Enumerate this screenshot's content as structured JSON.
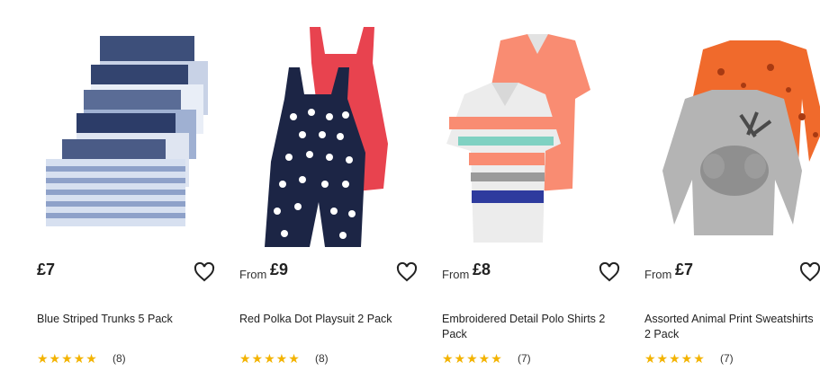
{
  "products": [
    {
      "from_label": "",
      "price": "£7",
      "title": "Blue Striped Trunks 5 Pack",
      "stars": "★★★★★",
      "reviews": "(8)",
      "image_icon": "striped-trunks-image"
    },
    {
      "from_label": "From",
      "price": "£9",
      "title": "Red Polka Dot Playsuit 2 Pack",
      "stars": "★★★★★",
      "reviews": "(8)",
      "image_icon": "polka-dot-playsuit-image"
    },
    {
      "from_label": "From",
      "price": "£8",
      "title": "Embroidered Detail Polo Shirts 2 Pack",
      "stars": "★★★★★",
      "reviews": "(7)",
      "image_icon": "polo-shirts-image"
    },
    {
      "from_label": "From",
      "price": "£7",
      "title": "Assorted Animal Print Sweatshirts 2 Pack",
      "stars": "★★★★★",
      "reviews": "(7)",
      "image_icon": "animal-sweatshirts-image"
    }
  ],
  "colors": {
    "star": "#f3b300",
    "text": "#222222"
  }
}
